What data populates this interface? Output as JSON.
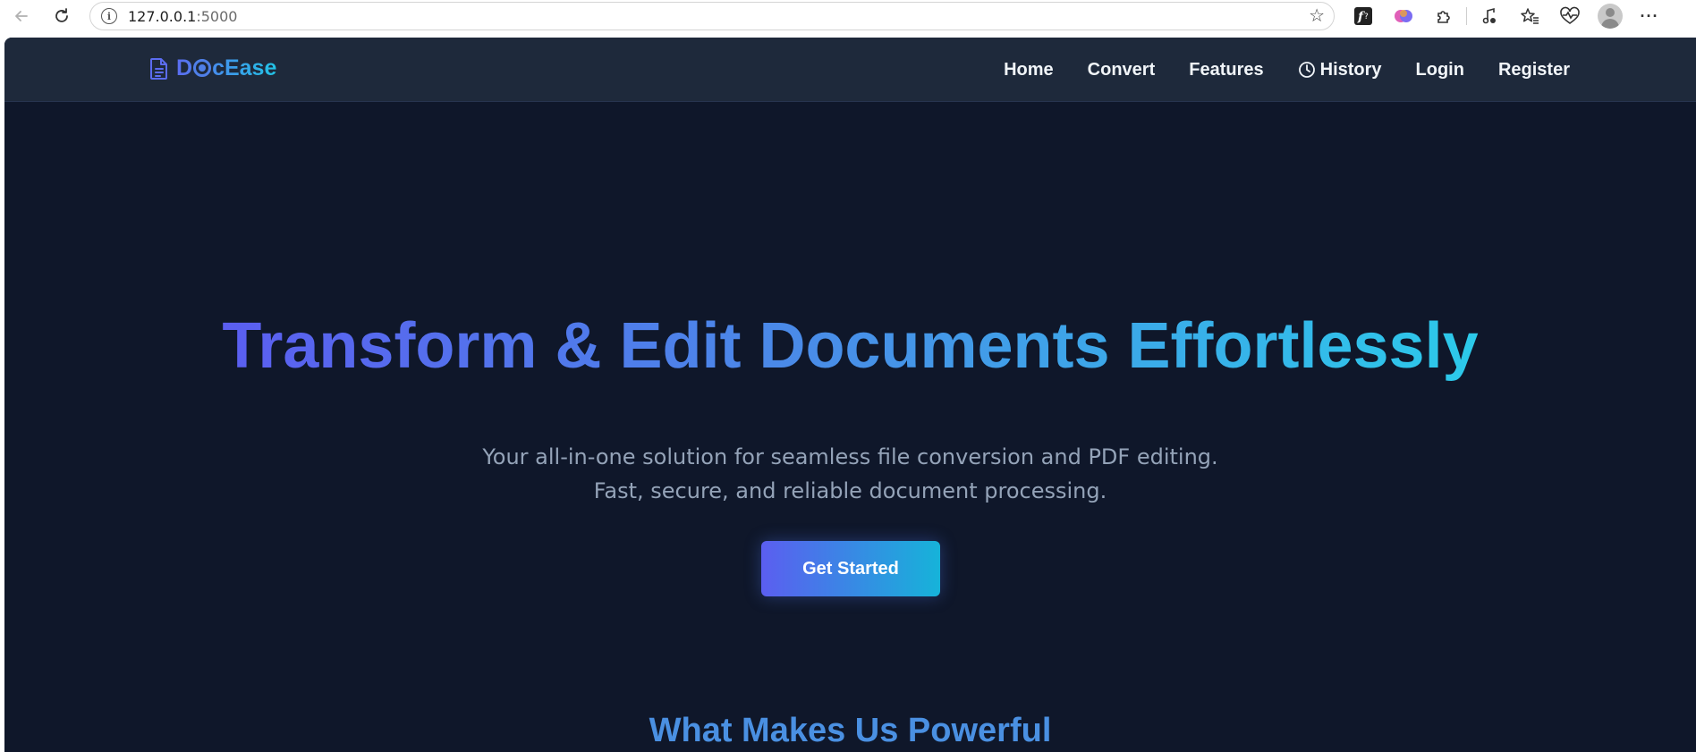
{
  "browser": {
    "url_host": "127.0.0.1",
    "url_port": ":5000",
    "back_icon": "arrow-left-icon",
    "reload_icon": "reload-icon",
    "info_icon": "info-icon",
    "bookmark_icon": "star-icon",
    "extensions": [
      "font-extension-icon",
      "brain-extension-icon",
      "puzzle-icon",
      "media-icon",
      "favorites-icon",
      "health-icon"
    ],
    "more_label": "···"
  },
  "navbar": {
    "brand": "DocEase",
    "brand_prefix": "D",
    "brand_suffix": "cEase",
    "links": [
      {
        "label": "Home"
      },
      {
        "label": "Convert"
      },
      {
        "label": "Features"
      },
      {
        "label": "History",
        "icon": "clock-icon"
      },
      {
        "label": "Login"
      },
      {
        "label": "Register"
      }
    ]
  },
  "hero": {
    "title": "Transform & Edit Documents Effortlessly",
    "subtitle_line1": "Your all-in-one solution for seamless file conversion and PDF editing.",
    "subtitle_line2": "Fast, secure, and reliable document processing.",
    "cta_label": "Get Started"
  },
  "features": {
    "heading": "What Makes Us Powerful"
  },
  "colors": {
    "page_bg": "#0f172a",
    "nav_bg": "#1e293b",
    "gradient_start": "#5b5ef0",
    "gradient_end": "#22c3e6",
    "subtitle": "#94a3b8"
  }
}
